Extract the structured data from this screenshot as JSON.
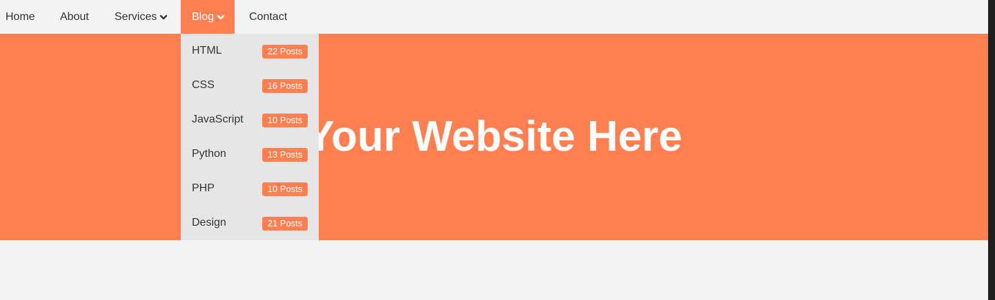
{
  "colors": {
    "accent": "#ff7f50",
    "nav_background": "#f3f3f3",
    "dropdown_background": "#e6e6e6",
    "text": "#333333",
    "hero_text": "#ffffff"
  },
  "nav": {
    "items": [
      {
        "label": "Home"
      },
      {
        "label": "About"
      },
      {
        "label": "Services",
        "icon": "chevron-down-icon"
      },
      {
        "label": "Blog",
        "icon": "chevron-down-icon",
        "active": true
      },
      {
        "label": "Contact"
      }
    ]
  },
  "dropdown": {
    "items": [
      {
        "label": "HTML",
        "badge": "22 Posts"
      },
      {
        "label": "CSS",
        "badge": "16 Posts"
      },
      {
        "label": "JavaScript",
        "badge": "10 Posts"
      },
      {
        "label": "Python",
        "badge": "13 Posts"
      },
      {
        "label": "PHP",
        "badge": "10 Posts"
      },
      {
        "label": "Design",
        "badge": "21 Posts"
      }
    ]
  },
  "hero": {
    "title": "Your Website Here"
  }
}
